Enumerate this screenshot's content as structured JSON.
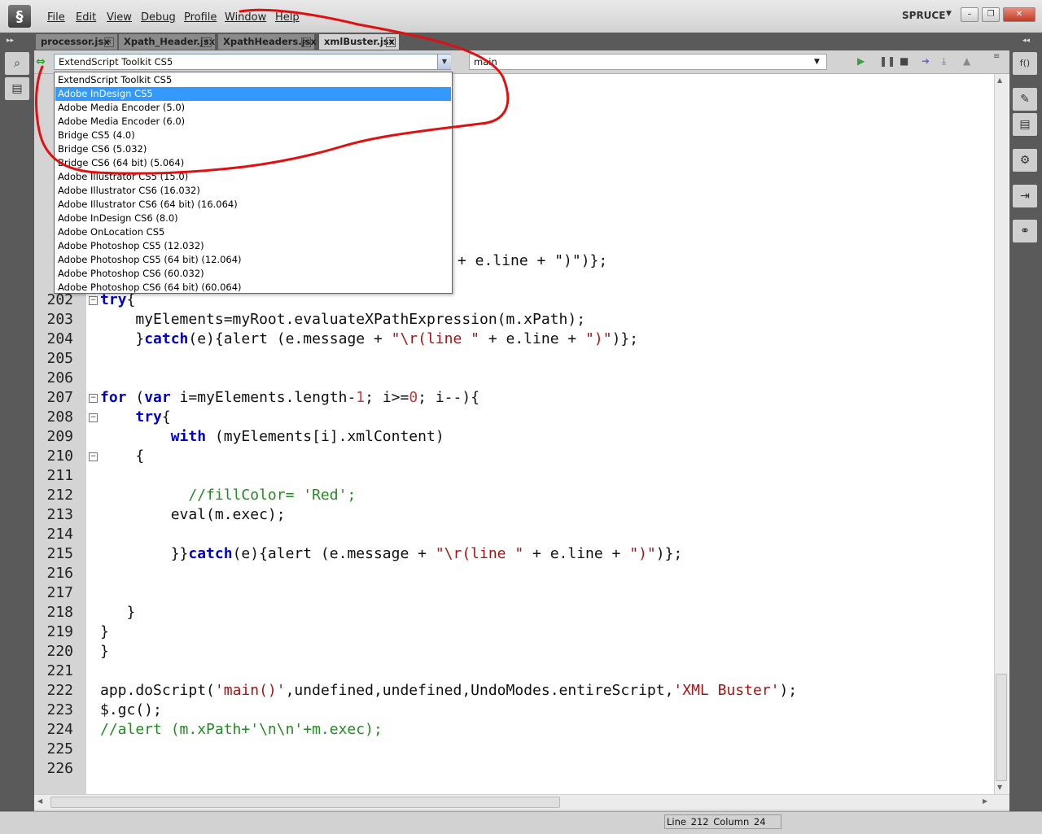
{
  "menubar": {
    "logo": "§",
    "items": [
      "File",
      "Edit",
      "View",
      "Debug",
      "Profile",
      "Window",
      "Help"
    ],
    "workspace": "SPRUCE"
  },
  "tabs": [
    {
      "label": "processor.jsx",
      "active": false
    },
    {
      "label": "Xpath_Header.jsx",
      "active": false
    },
    {
      "label": "XpathHeaders.jsx",
      "active": false
    },
    {
      "label": "xmlBuster.jsx",
      "active": true
    }
  ],
  "toolbar": {
    "target_value": "ExtendScript Toolkit CS5",
    "function_value": "main"
  },
  "dropdown": {
    "selected_index": 1,
    "options": [
      "ExtendScript Toolkit CS5",
      "Adobe InDesign CS5",
      "Adobe Media Encoder (5.0)",
      "Adobe Media Encoder (6.0)",
      "Bridge CS5 (4.0)",
      "Bridge CS6 (5.032)",
      "Bridge CS6 (64 bit) (5.064)",
      "Adobe Illustrator CS5 (15.0)",
      "Adobe Illustrator CS6 (16.032)",
      "Adobe Illustrator CS6 (64 bit) (16.064)",
      "Adobe InDesign CS6 (8.0)",
      "Adobe OnLocation CS5",
      "Adobe Photoshop CS5 (12.032)",
      "Adobe Photoshop CS5 (64 bit) (12.064)",
      "Adobe Photoshop CS6 (60.032)",
      "Adobe Photoshop CS6 (64 bit) (60.064)"
    ]
  },
  "editor": {
    "hidden_line_digits": [
      "1",
      "1",
      "1",
      "1",
      "1",
      "1",
      "1",
      "1",
      "1",
      "1",
      "1",
      "2",
      "2"
    ],
    "partial_line_text": "+ e.line + \")\")};",
    "lines": [
      {
        "n": "202",
        "text": "try{"
      },
      {
        "n": "203",
        "text": "    myElements=myRoot.evaluateXPathExpression(m.xPath);"
      },
      {
        "n": "204",
        "text": "    }catch(e){alert (e.message + \"\\r(line \" + e.line + \")\")};"
      },
      {
        "n": "205",
        "text": ""
      },
      {
        "n": "206",
        "text": ""
      },
      {
        "n": "207",
        "text": "for (var i=myElements.length-1; i>=0; i--){"
      },
      {
        "n": "208",
        "text": "    try{"
      },
      {
        "n": "209",
        "text": "        with (myElements[i].xmlContent)"
      },
      {
        "n": "210",
        "text": "    {"
      },
      {
        "n": "211",
        "text": ""
      },
      {
        "n": "212",
        "text": "          //fillColor= 'Red';"
      },
      {
        "n": "213",
        "text": "        eval(m.exec);"
      },
      {
        "n": "214",
        "text": ""
      },
      {
        "n": "215",
        "text": "        }}catch(e){alert (e.message + \"\\r(line \" + e.line + \")\")};"
      },
      {
        "n": "216",
        "text": ""
      },
      {
        "n": "217",
        "text": ""
      },
      {
        "n": "218",
        "text": "   }"
      },
      {
        "n": "219",
        "text": "}"
      },
      {
        "n": "220",
        "text": "}"
      },
      {
        "n": "221",
        "text": ""
      },
      {
        "n": "222",
        "text": "app.doScript('main()',undefined,undefined,UndoModes.entireScript,'XML Buster');"
      },
      {
        "n": "223",
        "text": "$.gc();"
      },
      {
        "n": "224",
        "text": "//alert (m.xPath+'\\n\\n'+m.exec);"
      },
      {
        "n": "225",
        "text": ""
      },
      {
        "n": "226",
        "text": ""
      }
    ]
  },
  "status": {
    "line": "Line 212",
    "column": "Column 24"
  },
  "colors": {
    "keyword": "#0000c8",
    "string": "#a31515",
    "comment": "#228b22",
    "annotation": "#e01010",
    "selection": "#3399ff"
  }
}
